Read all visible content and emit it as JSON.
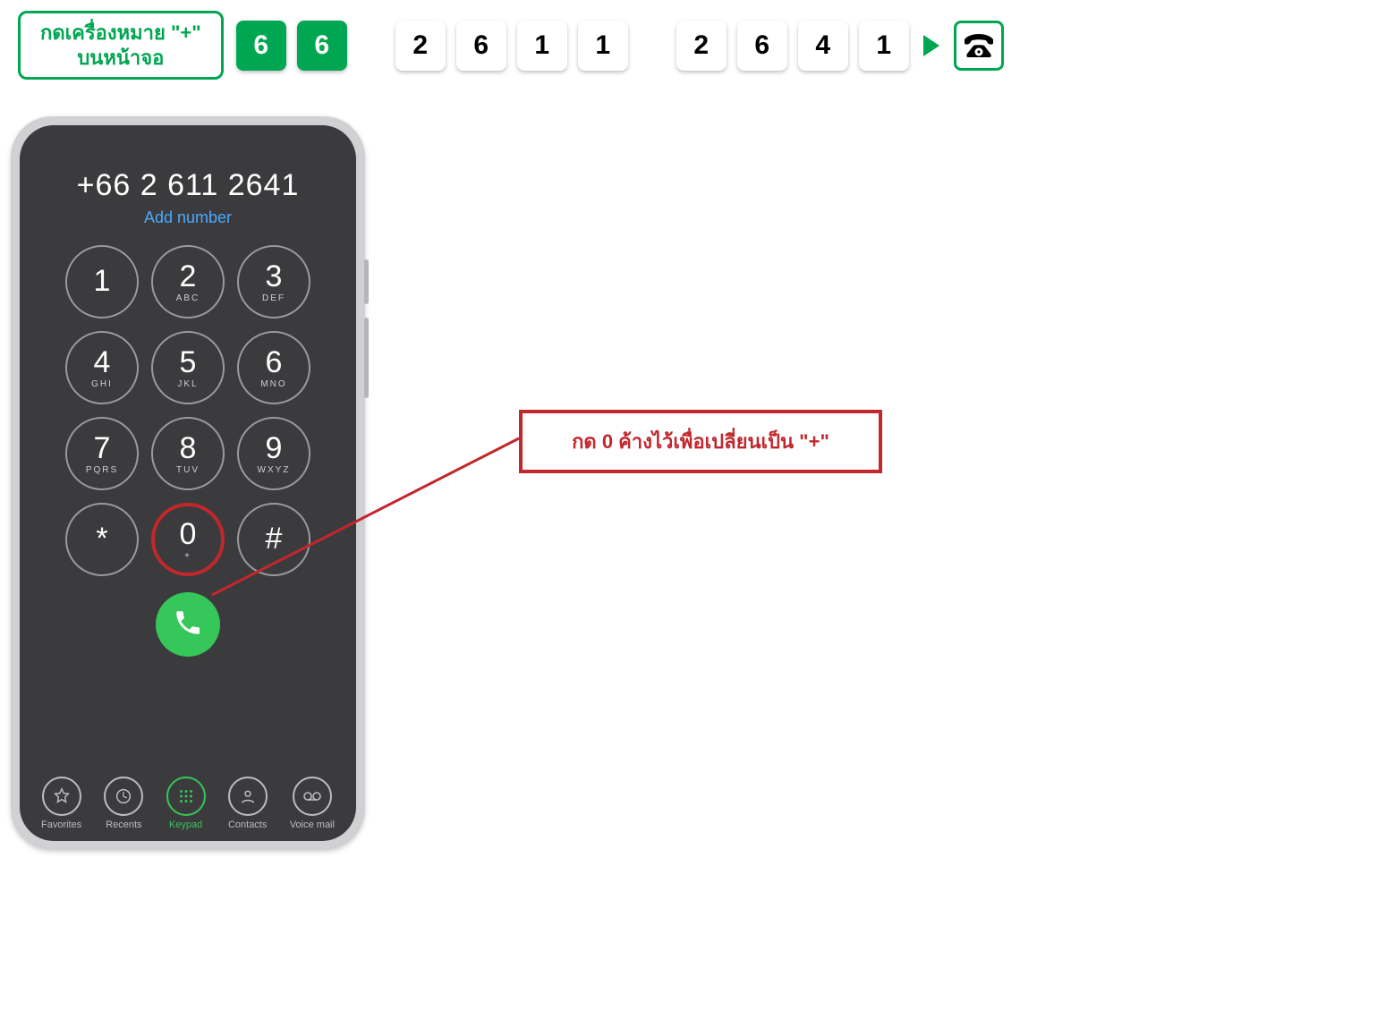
{
  "top": {
    "plus_instruction_line1": "กดเครื่องหมาย \"+\"",
    "plus_instruction_line2": "บนหน้าจอ",
    "digits_green": [
      "6",
      "6"
    ],
    "digits_group2": [
      "2",
      "6",
      "1",
      "1"
    ],
    "digits_group3": [
      "2",
      "6",
      "4",
      "1"
    ]
  },
  "phone": {
    "dialed_number": "+66 2 611 2641",
    "add_number": "Add number",
    "keys": [
      {
        "num": "1",
        "letters": ""
      },
      {
        "num": "2",
        "letters": "ABC"
      },
      {
        "num": "3",
        "letters": "DEF"
      },
      {
        "num": "4",
        "letters": "GHI"
      },
      {
        "num": "5",
        "letters": "JKL"
      },
      {
        "num": "6",
        "letters": "MNO"
      },
      {
        "num": "7",
        "letters": "PQRS"
      },
      {
        "num": "8",
        "letters": "TUV"
      },
      {
        "num": "9",
        "letters": "WXYZ"
      },
      {
        "num": "*",
        "letters": ""
      },
      {
        "num": "0",
        "letters": "+"
      },
      {
        "num": "#",
        "letters": ""
      }
    ],
    "tabs": [
      {
        "label": "Favorites"
      },
      {
        "label": "Recents"
      },
      {
        "label": "Keypad"
      },
      {
        "label": "Contacts"
      },
      {
        "label": "Voice mail"
      }
    ],
    "active_tab_index": 2
  },
  "callout": {
    "text": "กด 0 ค้างไว้เพื่อเปลี่ยนเป็น \"+\""
  }
}
